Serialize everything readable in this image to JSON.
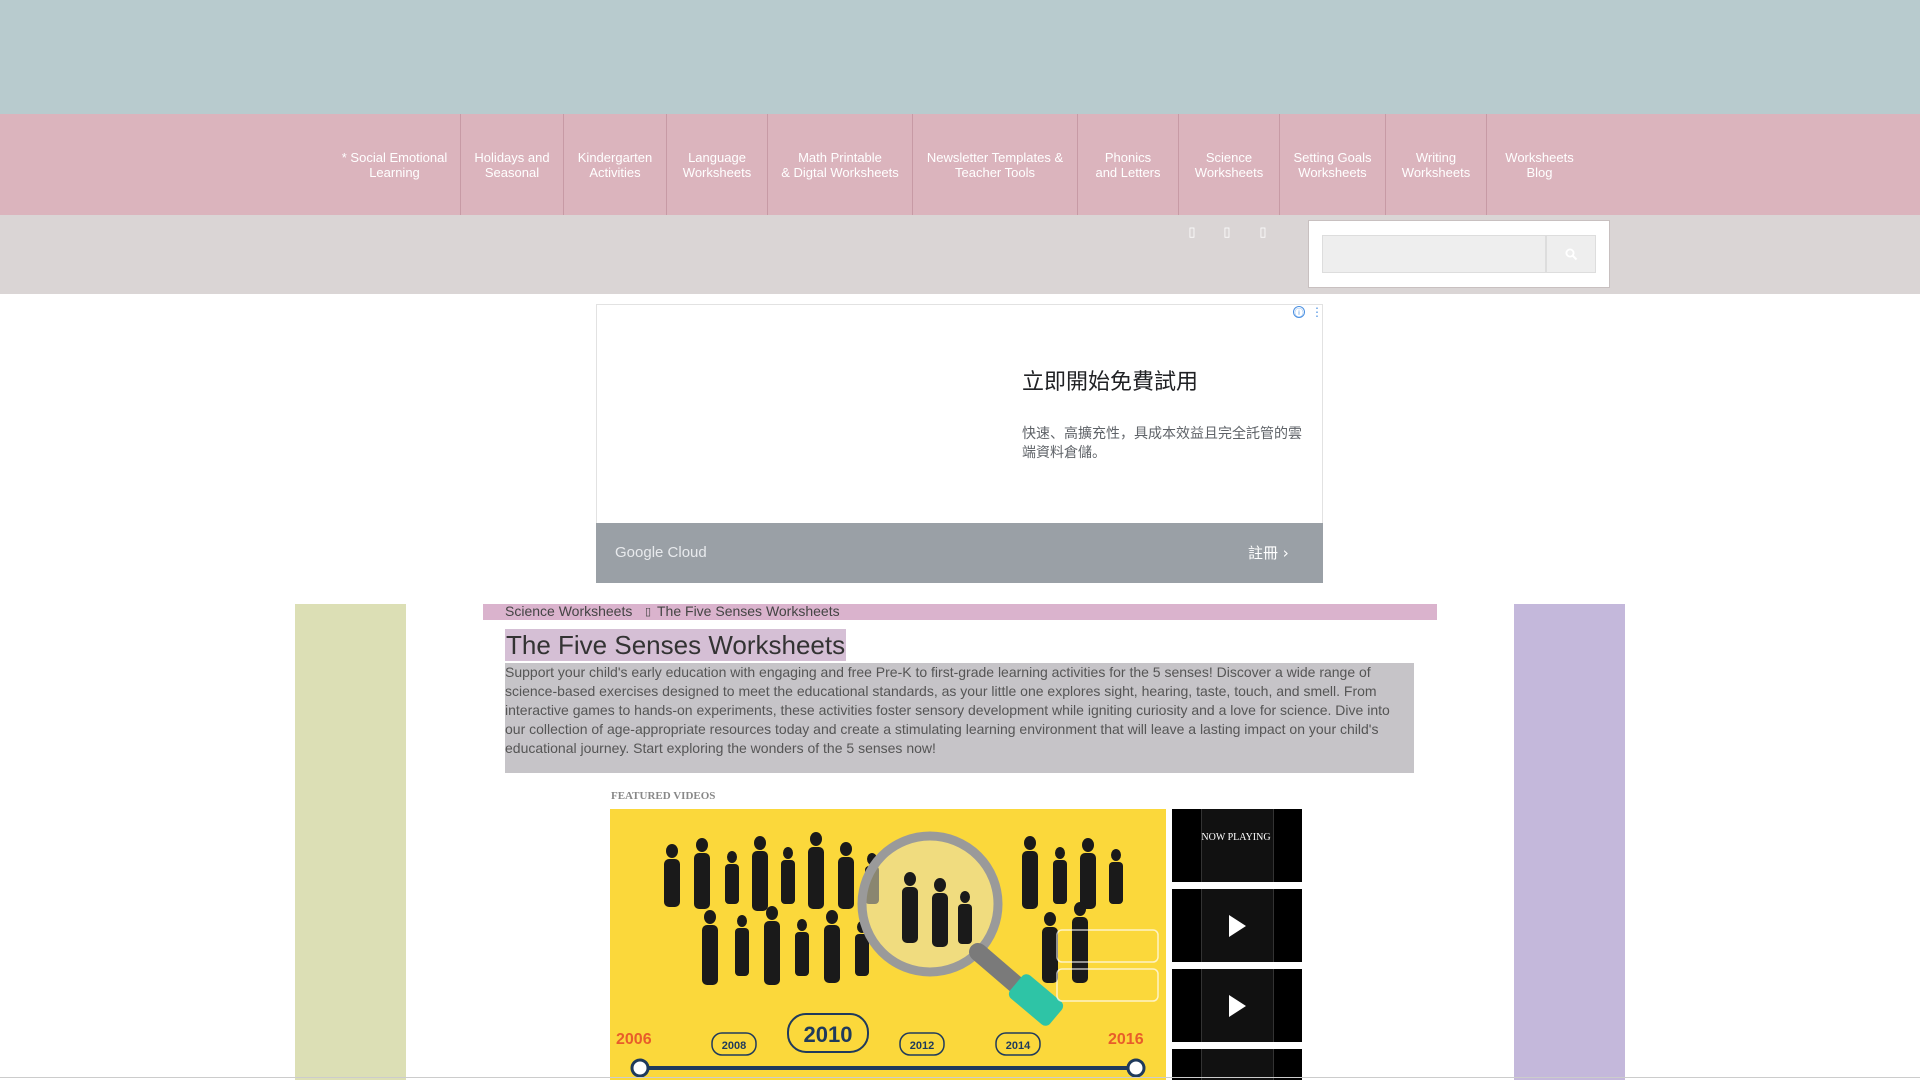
{
  "nav": {
    "items": [
      {
        "line1": "* Social Emotional",
        "line2": "Learning"
      },
      {
        "line1": "Holidays and",
        "line2": "Seasonal"
      },
      {
        "line1": "Kindergarten",
        "line2": "Activities"
      },
      {
        "line1": "Language",
        "line2": "Worksheets"
      },
      {
        "line1": "Math Printable",
        "line2": "& Digtal Worksheets"
      },
      {
        "line1": "Newsletter Templates &",
        "line2": "Teacher Tools"
      },
      {
        "line1": "Phonics",
        "line2": "and Letters"
      },
      {
        "line1": "Science",
        "line2": "Worksheets"
      },
      {
        "line1": "Setting Goals",
        "line2": "Worksheets"
      },
      {
        "line1": "Writing",
        "line2": "Worksheets"
      },
      {
        "line1": "Worksheets",
        "line2": "Blog"
      }
    ]
  },
  "social_icons": [
    "facebook-icon",
    "twitter-icon",
    "pinterest-icon"
  ],
  "search": {
    "icon": "search-icon"
  },
  "ad": {
    "headline": "立即開始免費試用",
    "body": "快速、高擴充性，具成本效益且完全託管的雲端資料倉儲。",
    "brand": "Google Cloud",
    "cta": "註冊",
    "info_icon": "ⓘ"
  },
  "breadcrumb": {
    "items": [
      "Science Worksheets",
      "The Five Senses Worksheets"
    ]
  },
  "page": {
    "title": "The Five Senses Worksheets",
    "description": "Support your child's early education with engaging and free Pre-K to first-grade learning activities for the 5 senses! Discover a wide range of science-based exercises designed to meet the educational standards, as your little one explores sight, hearing, taste, touch, and smell. From interactive games to hands-on experiments, these activities foster sensory development while igniting curiosity and a love for science. Dive into our collection of age-appropriate resources today and create a stimulating learning environment that will leave a lasting impact on your child's educational journey. Start exploring the wonders of the 5 senses now!"
  },
  "videos": {
    "label": "FEATURED VIDEOS",
    "now_playing": "NOW PLAYING",
    "timeline_years": [
      "2006",
      "2008",
      "2010",
      "2012",
      "2014",
      "2016"
    ]
  },
  "colors": {
    "top_band": "#b8cbce",
    "nav_bar": "#dbb4bd",
    "sub_bar": "#dad5d5",
    "left_column": "#dcdfb5",
    "right_column": "#c4b8db",
    "breadcrumb_bar": "#dab3cd",
    "video_bg": "#fbd83b"
  }
}
